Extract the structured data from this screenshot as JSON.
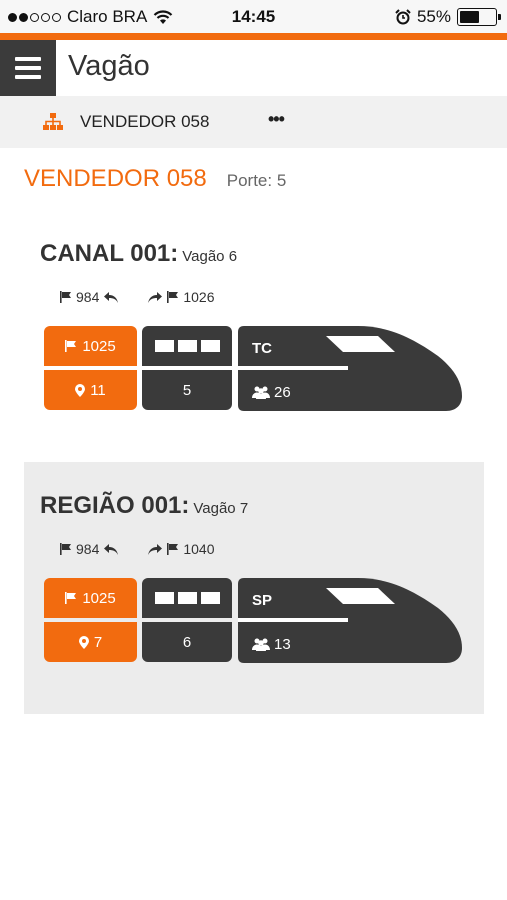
{
  "status_bar": {
    "carrier": "Claro BRA",
    "time": "14:45",
    "battery": "55%",
    "battery_level": 0.55
  },
  "app_bar": {
    "title": "Vagão"
  },
  "sub_bar": {
    "seller": "VENDEDOR 058",
    "more": "•••"
  },
  "header": {
    "seller_title": "VENDEDOR 058",
    "porte": "Porte: 5"
  },
  "colors": {
    "accent": "#f26b0f",
    "dark": "#3a3a3a"
  },
  "cards": [
    {
      "name": "CANAL 001:",
      "vagao": "Vagão 6",
      "port_in": "984",
      "port_out": "1026",
      "flag_value": "1025",
      "location_value": "11",
      "segment_count": "5",
      "loco_code": "TC",
      "passengers": "26"
    },
    {
      "name": "REGIÃO 001:",
      "vagao": "Vagão 7",
      "port_in": "984",
      "port_out": "1040",
      "flag_value": "1025",
      "location_value": "7",
      "segment_count": "6",
      "loco_code": "SP",
      "passengers": "13"
    }
  ]
}
